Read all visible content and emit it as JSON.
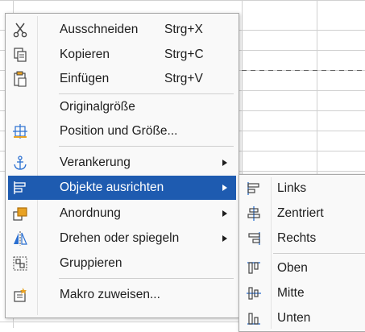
{
  "context_menu": {
    "items": [
      {
        "label": "Ausschneiden",
        "shortcut": "Strg+X",
        "icon": "scissors-icon"
      },
      {
        "label": "Kopieren",
        "shortcut": "Strg+C",
        "icon": "copy-icon"
      },
      {
        "label": "Einfügen",
        "shortcut": "Strg+V",
        "icon": "paste-icon"
      },
      {
        "label": "Originalgröße",
        "shortcut": "",
        "icon": ""
      },
      {
        "label": "Position und Größe...",
        "shortcut": "",
        "icon": "position-size-icon"
      },
      {
        "label": "Verankerung",
        "shortcut": "",
        "icon": "anchor-icon",
        "submenu": true
      },
      {
        "label": "Objekte ausrichten",
        "shortcut": "",
        "icon": "align-objects-icon",
        "submenu": true,
        "highlighted": true
      },
      {
        "label": "Anordnung",
        "shortcut": "",
        "icon": "arrange-icon",
        "submenu": true
      },
      {
        "label": "Drehen oder spiegeln",
        "shortcut": "",
        "icon": "rotate-flip-icon",
        "submenu": true
      },
      {
        "label": "Gruppieren",
        "shortcut": "",
        "icon": "group-icon"
      },
      {
        "label": "Makro zuweisen...",
        "shortcut": "",
        "icon": "assign-macro-icon"
      }
    ]
  },
  "align_submenu": {
    "items": [
      {
        "label": "Links",
        "icon": "align-left-icon"
      },
      {
        "label": "Zentriert",
        "icon": "align-center-icon"
      },
      {
        "label": "Rechts",
        "icon": "align-right-icon"
      },
      {
        "label": "Oben",
        "icon": "align-top-icon"
      },
      {
        "label": "Mitte",
        "icon": "align-middle-icon"
      },
      {
        "label": "Unten",
        "icon": "align-bottom-icon"
      }
    ]
  },
  "colors": {
    "highlight": "#1e5bb0",
    "icon_blue": "#2a6fd1",
    "icon_orange": "#e8a224"
  }
}
